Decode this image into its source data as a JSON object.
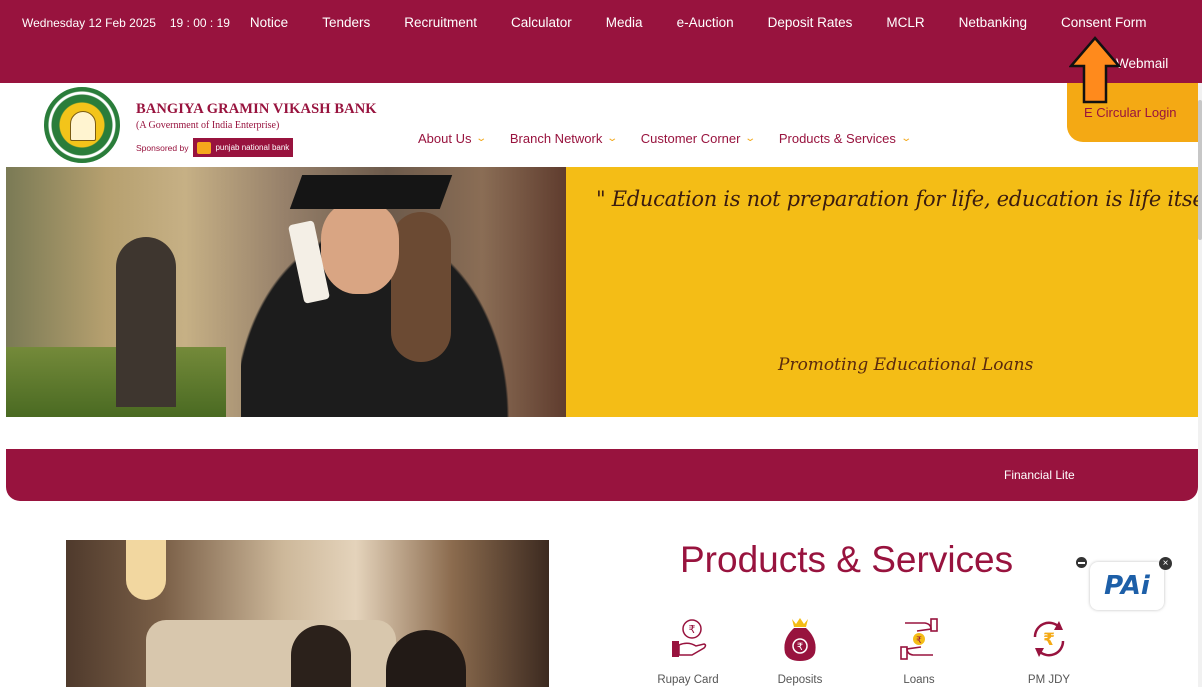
{
  "topbar": {
    "date": "Wednesday 12 Feb 2025",
    "time": "19 : 00 : 19",
    "links": [
      "Notice",
      "Tenders",
      "Recruitment",
      "Calculator",
      "Media",
      "e-Auction",
      "Deposit Rates",
      "MCLR",
      "Netbanking",
      "Consent Form"
    ],
    "webmail": "Webmail"
  },
  "brand": {
    "name": "BANGIYA GRAMIN VIKASH BANK",
    "subtitle": "(A Government of India Enterprise)",
    "sponsored_by": "Sponsored by",
    "sponsor_name": "punjab national bank"
  },
  "mainnav": [
    "About Us",
    "Branch Network",
    "Customer Corner",
    "Products & Services"
  ],
  "ecircular": "E Circular Login",
  "hero": {
    "quote": "\" Education is not preparation for life, education is life itself \"",
    "tagline": "Promoting Educational Loans"
  },
  "ticker": "Financial Lite",
  "products": {
    "title": "Products & Services",
    "items": [
      "Rupay Card",
      "Deposits",
      "Loans",
      "PM JDY"
    ]
  },
  "chatbot": {
    "label": "PAi"
  },
  "colors": {
    "maroon": "#98133e",
    "amber": "#f4a914",
    "yellow": "#f4bd16",
    "arrow": "#ff8a1c"
  }
}
